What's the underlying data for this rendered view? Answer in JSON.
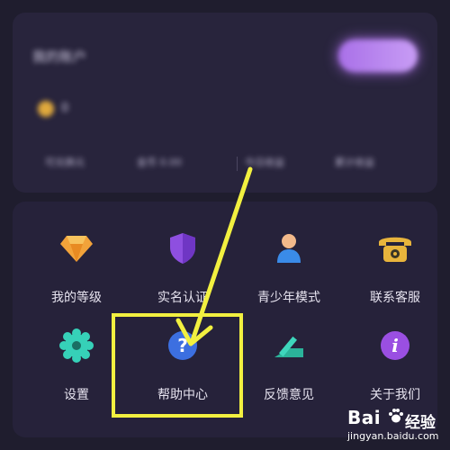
{
  "account": {
    "title": "我的账户",
    "coins": "0",
    "stats": [
      "可兑换元",
      "金币 0.00",
      "今日收益",
      "累计收益"
    ]
  },
  "services": [
    {
      "label": "我的等级",
      "icon": "diamond-icon"
    },
    {
      "label": "实名认证",
      "icon": "shield-icon"
    },
    {
      "label": "青少年模式",
      "icon": "person-icon"
    },
    {
      "label": "联系客服",
      "icon": "telephone-icon"
    },
    {
      "label": "设置",
      "icon": "gear-icon"
    },
    {
      "label": "帮助中心",
      "icon": "help-icon"
    },
    {
      "label": "反馈意见",
      "icon": "feedback-icon"
    },
    {
      "label": "关于我们",
      "icon": "info-icon"
    }
  ],
  "watermark": {
    "logo": "Bai",
    "brand": "经验",
    "url": "jingyan.baidu.com"
  },
  "colors": {
    "background": "#1f1d2e",
    "card": "#26223a",
    "accent_purple": "#a970e8",
    "annotation_yellow": "#f2f040"
  }
}
